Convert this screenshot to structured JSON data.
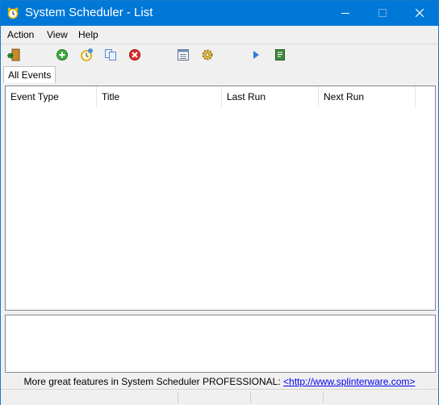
{
  "window": {
    "title": "System Scheduler - List"
  },
  "menu": {
    "action": "Action",
    "view": "View",
    "help": "Help"
  },
  "toolbar": {
    "icons": [
      "exit-icon",
      "add-icon",
      "new-event-icon",
      "copy-icon",
      "delete-icon",
      "list-view-icon",
      "settings-icon",
      "run-icon",
      "log-icon"
    ]
  },
  "tabs": [
    {
      "label": "All Events"
    }
  ],
  "table": {
    "columns": [
      "Event Type",
      "Title",
      "Last Run",
      "Next Run"
    ],
    "rows": []
  },
  "promo": {
    "text": "More great features in System Scheduler PROFESSIONAL:",
    "link": "<http://www.splinterware.com>"
  },
  "colors": {
    "titlebar": "#0078d7",
    "window_bg": "#f0f0f0",
    "link": "#0000ee"
  }
}
